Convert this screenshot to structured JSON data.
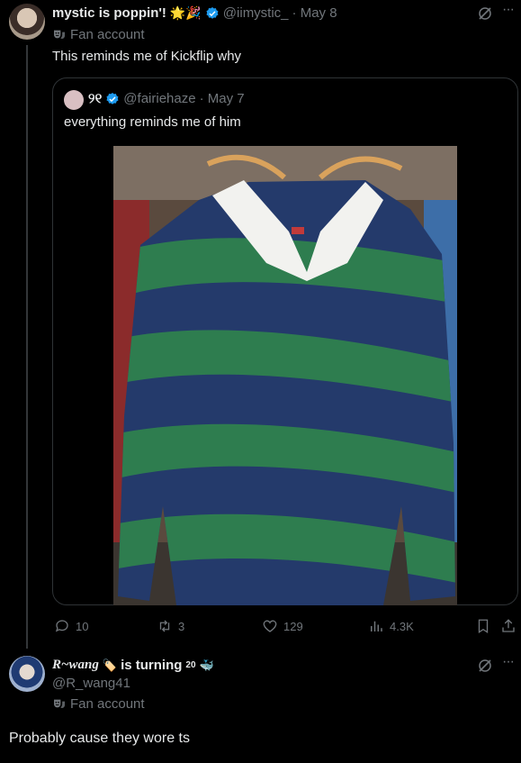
{
  "tweet1": {
    "display_name": "mystic is poppin'!",
    "name_emoji": "🌟🎉",
    "handle": "@iimystic_",
    "date": "· May 8",
    "badge_label": "Fan account",
    "text": "This reminds me of Kickflip why"
  },
  "quote": {
    "display_name": "୨୧",
    "handle": "@fairiehaze",
    "date": "· May 7",
    "text": "everything reminds me of him"
  },
  "actions": {
    "replies": "10",
    "reposts": "3",
    "likes": "129",
    "views": "4.3K"
  },
  "tweet2": {
    "display_name": "R~wang",
    "name_suffix": "is turning",
    "superscript": "20",
    "handle": "@R_wang41",
    "badge_label": "Fan account",
    "text": "Probably cause they wore ts"
  },
  "colors": {
    "background": "#000000",
    "verified_blue": "#1d9bf0",
    "muted": "#71767b",
    "stripe_green": "#2e7d4f",
    "stripe_navy": "#243a6b"
  }
}
